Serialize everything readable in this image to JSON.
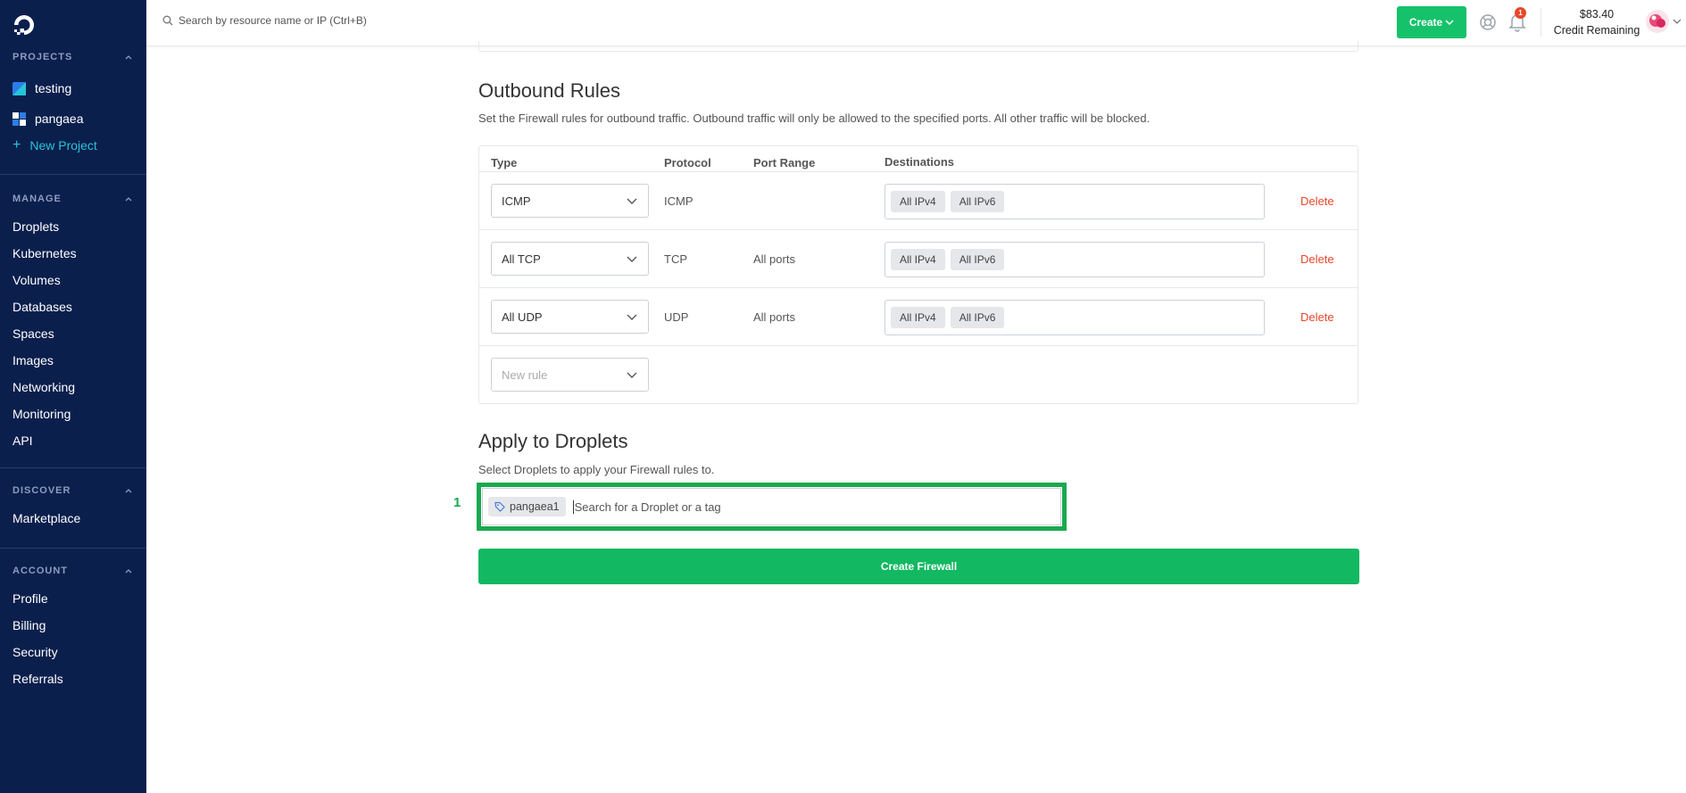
{
  "sidebar": {
    "projects_header": "PROJECTS",
    "projects": [
      {
        "label": "testing"
      },
      {
        "label": "pangaea"
      }
    ],
    "new_project_label": "New Project",
    "manage_header": "MANAGE",
    "manage_items": [
      "Droplets",
      "Kubernetes",
      "Volumes",
      "Databases",
      "Spaces",
      "Images",
      "Networking",
      "Monitoring",
      "API"
    ],
    "discover_header": "DISCOVER",
    "discover_items": [
      "Marketplace"
    ],
    "account_header": "ACCOUNT",
    "account_items": [
      "Profile",
      "Billing",
      "Security",
      "Referrals"
    ]
  },
  "topbar": {
    "search_placeholder": "Search by resource name or IP (Ctrl+B)",
    "create_label": "Create",
    "notification_count": "1",
    "credit_amount": "$83.40",
    "credit_label": "Credit Remaining"
  },
  "outbound": {
    "title": "Outbound Rules",
    "description": "Set the Firewall rules for outbound traffic. Outbound traffic will only be allowed to the specified ports. All other traffic will be blocked.",
    "columns": {
      "type": "Type",
      "protocol": "Protocol",
      "port_range": "Port Range",
      "destinations": "Destinations"
    },
    "rules": [
      {
        "type": "ICMP",
        "protocol": "ICMP",
        "port_range": "",
        "destinations": [
          "All IPv4",
          "All IPv6"
        ],
        "action": "Delete"
      },
      {
        "type": "All TCP",
        "protocol": "TCP",
        "port_range": "All ports",
        "destinations": [
          "All IPv4",
          "All IPv6"
        ],
        "action": "Delete"
      },
      {
        "type": "All UDP",
        "protocol": "UDP",
        "port_range": "All ports",
        "destinations": [
          "All IPv4",
          "All IPv6"
        ],
        "action": "Delete"
      }
    ],
    "new_rule_placeholder": "New rule"
  },
  "apply": {
    "title": "Apply to Droplets",
    "description": "Select Droplets to apply your Firewall rules to.",
    "step_number": "1",
    "selected_tag": "pangaea1",
    "search_placeholder": "Search for a Droplet or a tag"
  },
  "create_firewall_label": "Create Firewall",
  "colors": {
    "sidebar_bg": "#0b1f4d",
    "accent_green": "#15c26b",
    "delete_red": "#e8472b",
    "highlight_green": "#1aa84f",
    "link_cyan": "#27c4d8"
  }
}
